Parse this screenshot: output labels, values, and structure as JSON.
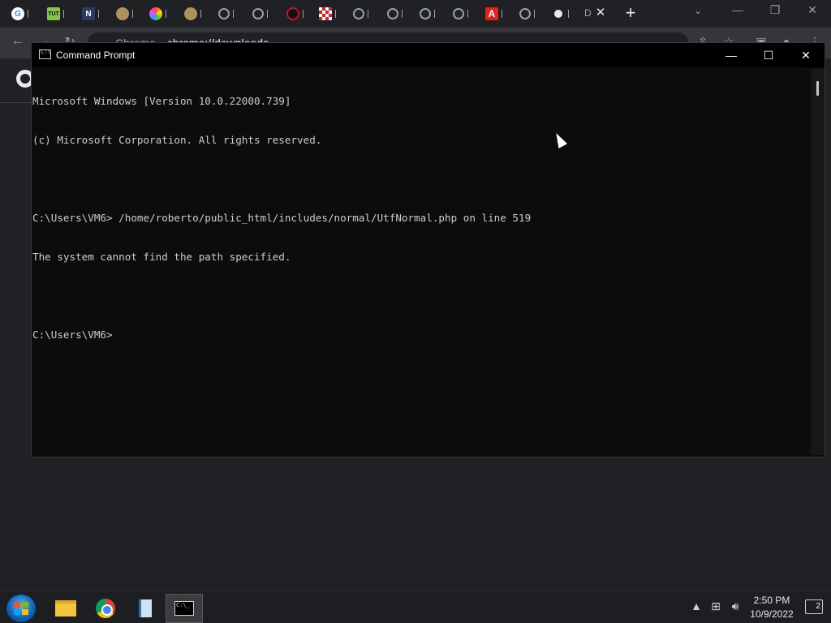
{
  "browser": {
    "tabs": [
      {
        "icon": "google-icon",
        "trail": "'"
      },
      {
        "icon": "vmix-tut-icon",
        "trail": "V"
      },
      {
        "icon": "napster-icon",
        "trail": "V"
      },
      {
        "icon": "shield-emblem-icon",
        "trail": "E"
      },
      {
        "icon": "color-wheel-icon",
        "trail": "I"
      },
      {
        "icon": "shield-emblem-icon",
        "trail": "E"
      },
      {
        "icon": "globe-icon",
        "trail": "I"
      },
      {
        "icon": "globe-icon",
        "trail": "I"
      },
      {
        "icon": "debian-swirl-icon",
        "trail": "I"
      },
      {
        "icon": "checker-icon",
        "trail": "I"
      },
      {
        "icon": "globe-icon",
        "trail": "I"
      },
      {
        "icon": "globe-icon",
        "trail": "I"
      },
      {
        "icon": "globe-icon",
        "trail": "I"
      },
      {
        "icon": "globe-icon",
        "trail": "I"
      },
      {
        "icon": "acrobat-icon",
        "trail": "I"
      },
      {
        "icon": "globe-icon",
        "trail": "I"
      },
      {
        "icon": "github-icon",
        "trail": "I"
      }
    ],
    "active_tab_label": "D",
    "address": {
      "site": "Chrome",
      "path": "chrome://downloads"
    }
  },
  "cmd": {
    "title": "Command Prompt",
    "lines": [
      "Microsoft Windows [Version 10.0.22000.739]",
      "(c) Microsoft Corporation. All rights reserved.",
      "",
      "C:\\Users\\VM6> /home/roberto/public_html/includes/normal/UtfNormal.php on line 519",
      "The system cannot find the path specified.",
      "",
      "C:\\Users\\VM6>"
    ]
  },
  "taskbar": {
    "apps": [
      "file-explorer",
      "chrome",
      "notepad",
      "command-prompt"
    ],
    "active_app": "command-prompt",
    "clock": {
      "time": "2:50 PM",
      "date": "10/9/2022"
    },
    "notifications": "2"
  }
}
